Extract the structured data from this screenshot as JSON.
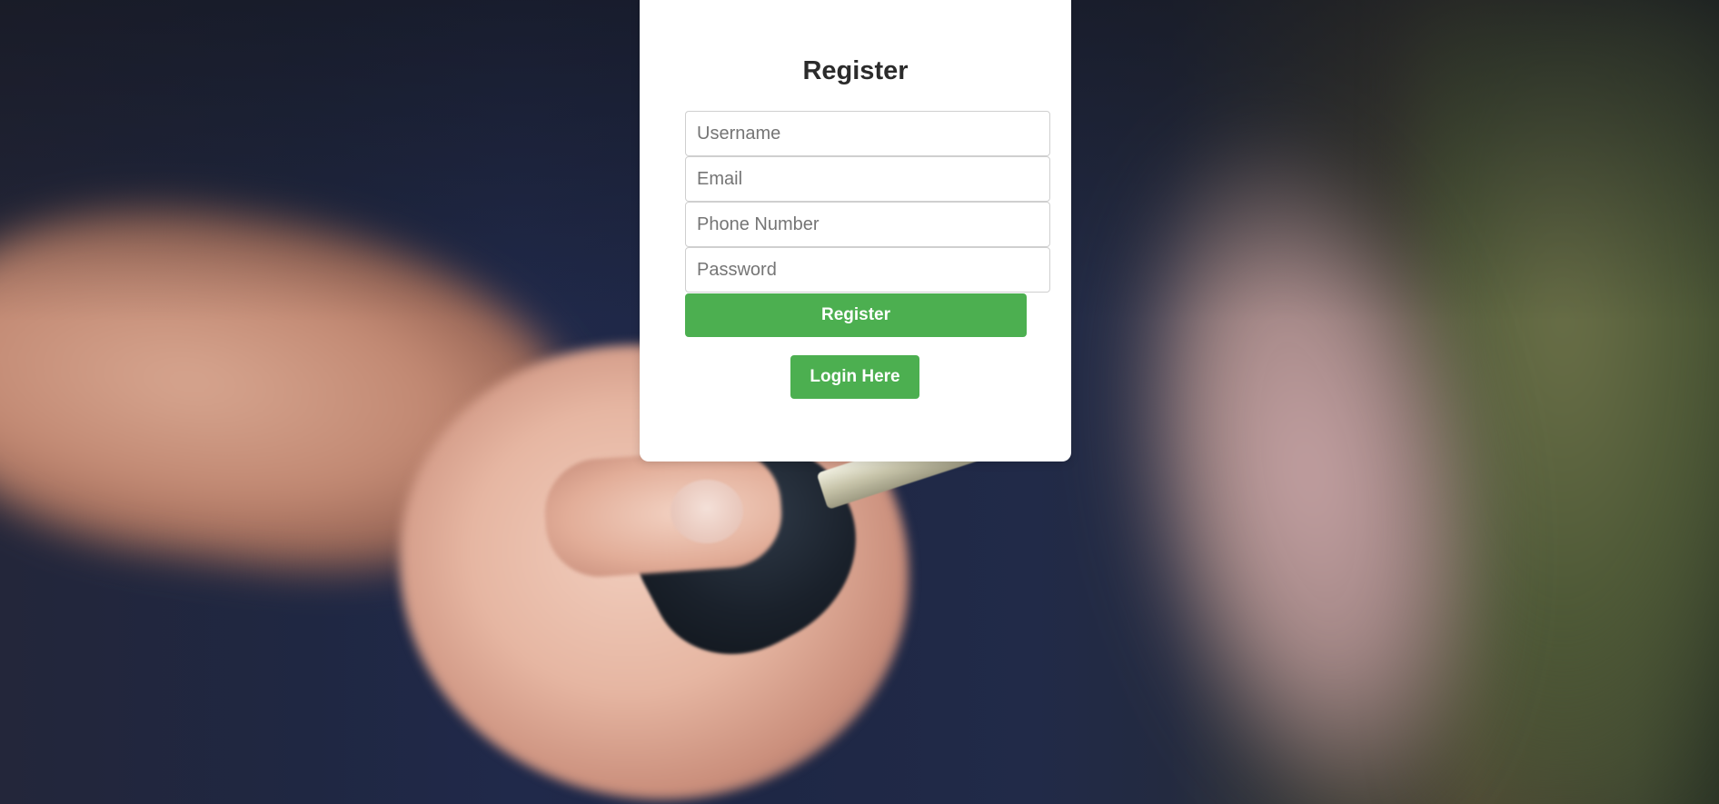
{
  "page": {
    "background": "blurred photo of a hand holding a car key"
  },
  "register_form": {
    "title": "Register",
    "username": {
      "placeholder": "Username",
      "value": ""
    },
    "email": {
      "placeholder": "Email",
      "value": ""
    },
    "phone": {
      "placeholder": "Phone Number",
      "value": ""
    },
    "password": {
      "placeholder": "Password",
      "value": ""
    },
    "submit_label": "Register",
    "login_link_label": "Login Here"
  },
  "colors": {
    "button": "#4caf50",
    "button_text": "#ffffff",
    "card": "#ffffff",
    "title": "#2b2b2b"
  }
}
